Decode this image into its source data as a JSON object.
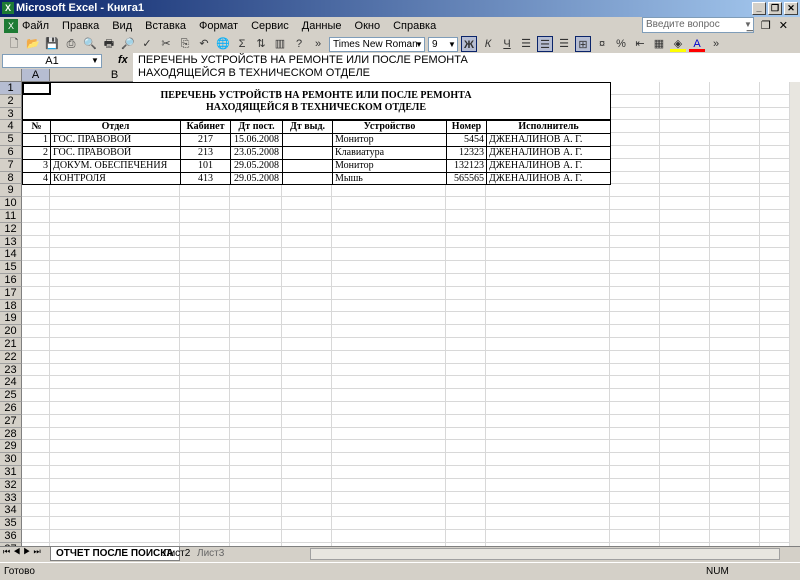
{
  "window": {
    "title": "Microsoft Excel - Книга1"
  },
  "menu": [
    "Файл",
    "Правка",
    "Вид",
    "Вставка",
    "Формат",
    "Сервис",
    "Данные",
    "Окно",
    "Справка"
  ],
  "help_placeholder": "Введите вопрос",
  "toolbar": {
    "font": "Times New Roman",
    "size": "9",
    "bold": "Ж",
    "italic": "К",
    "underline": "Ч"
  },
  "formula": {
    "cell": "A1",
    "fx": "fx",
    "text1": "ПЕРЕЧЕНЬ УСТРОЙСТВ НА РЕМОНТЕ ИЛИ ПОСЛЕ РЕМОНТА",
    "text2": "НАХОДЯЩЕЙСЯ В ТЕХНИЧЕСКОМ ОТДЕЛЕ"
  },
  "columns": [
    "A",
    "B"
  ],
  "sheet": {
    "title1": "ПЕРЕЧЕНЬ УСТРОЙСТВ НА РЕМОНТЕ ИЛИ ПОСЛЕ РЕМОНТА",
    "title2": "НАХОДЯЩЕЙСЯ В ТЕХНИЧЕСКОМ ОТДЕЛЕ",
    "headers": [
      "№",
      "Отдел",
      "Кабинет",
      "Дт пост.",
      "Дт выд.",
      "Устройство",
      "Номер",
      "Исполнитель"
    ],
    "rows": [
      [
        "1",
        "ГОС. ПРАВОВОЙ",
        "217",
        "15.06.2008",
        "",
        "Монитор",
        "5454",
        "ДЖЕНАЛИНОВ А. Г."
      ],
      [
        "2",
        "ГОС. ПРАВОВОЙ",
        "213",
        "23.05.2008",
        "",
        "Клавиатура",
        "12323",
        "ДЖЕНАЛИНОВ А. Г."
      ],
      [
        "3",
        "ДОКУМ. ОБЕСПЕЧЕНИЯ",
        "101",
        "29.05.2008",
        "",
        "Монитор",
        "132123",
        "ДЖЕНАЛИНОВ А. Г."
      ],
      [
        "4",
        "КОНТРОЛЯ",
        "413",
        "29.05.2008",
        "",
        "Мышь",
        "565565",
        "ДЖЕНАЛИНОВ А. Г."
      ]
    ]
  },
  "tabs": [
    "ОТЧЕТ ПОСЛЕ ПОИСКА",
    "Лист2",
    "Лист3"
  ],
  "status": {
    "left": "Готово",
    "num": "NUM"
  }
}
